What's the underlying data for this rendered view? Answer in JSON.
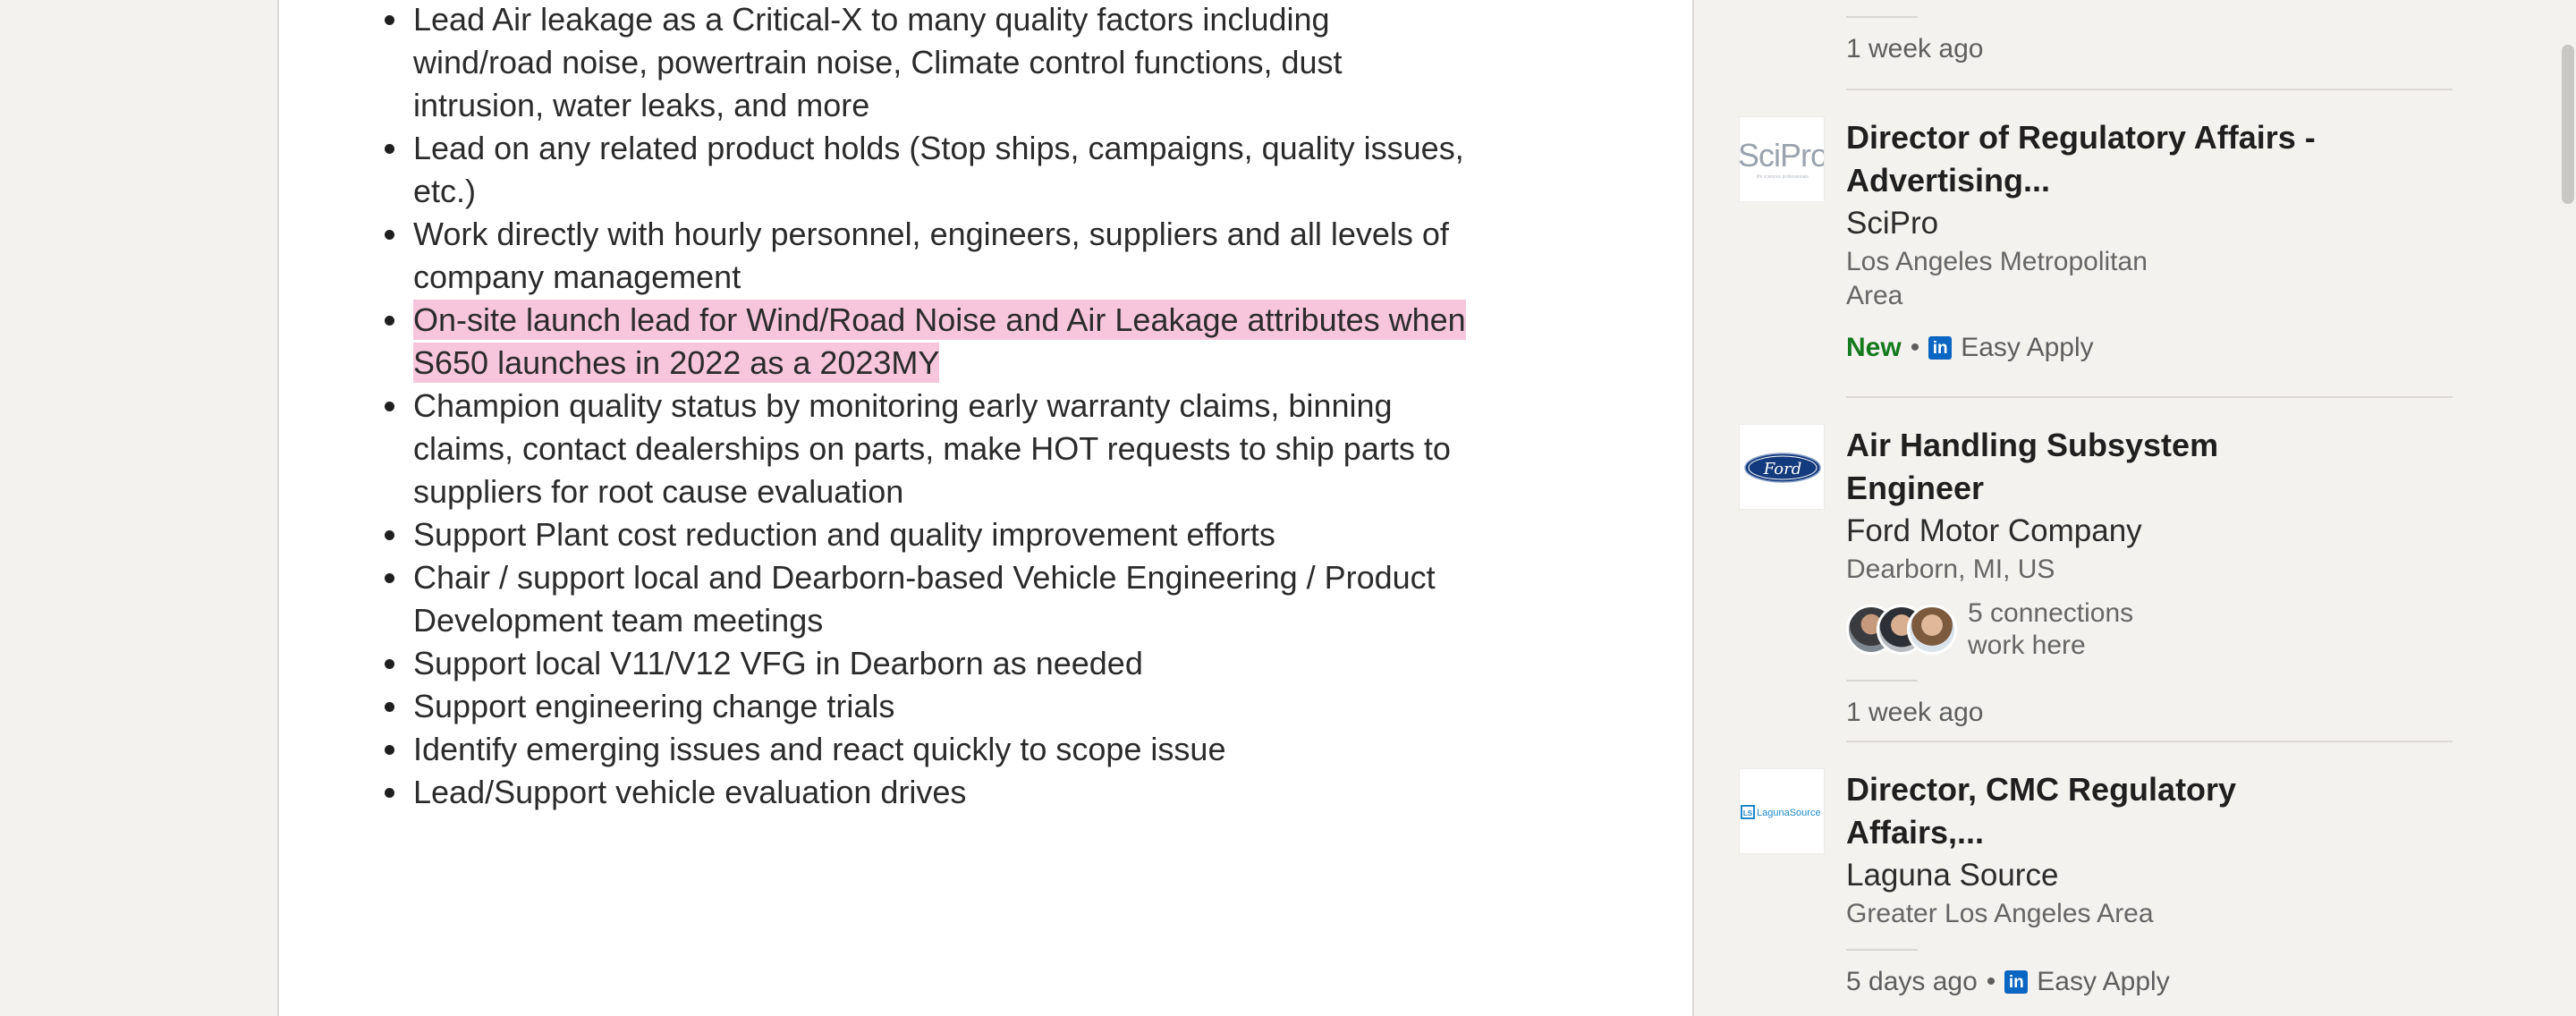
{
  "description": {
    "items": [
      "Lead Air leakage as a Critical-X to many quality factors including wind/road noise, powertrain noise, Climate control functions, dust intrusion, water leaks, and more",
      "Lead on any related product holds (Stop ships, campaigns, quality issues, etc.)",
      "Work directly with hourly personnel, engineers, suppliers and all levels of company management",
      "On-site launch lead for Wind/Road Noise and Air Leakage attributes when S650 launches in 2022 as a 2023MY",
      "Champion quality status by monitoring early warranty claims, binning claims, contact dealerships on parts, make HOT requests to ship parts to suppliers for root cause evaluation",
      "Support Plant cost reduction and quality improvement efforts",
      "Chair / support local and Dearborn-based Vehicle Engineering / Product Development team meetings",
      "Support local V11/V12 VFG in Dearborn as needed",
      "Support engineering change trials",
      "Identify emerging issues and react quickly to scope issue",
      "Lead/Support vehicle evaluation drives"
    ],
    "highlighted_index": 3,
    "highlight_color": "#f7c6dd"
  },
  "recommendations": {
    "top_time": "1 week ago",
    "jobs": [
      {
        "logo_icon": "scipro-logo",
        "logo_text": "SciPro",
        "logo_subtext": "life sciences professionals",
        "title": "Director of Regulatory Affairs - Advertising...",
        "company": "SciPro",
        "location": "Los Angeles Metropolitan Area",
        "new_label": "New",
        "dot": "•",
        "easy_apply": "Easy Apply",
        "li_glyph": "in"
      },
      {
        "logo_icon": "ford-logo",
        "logo_text": "Ford",
        "title": "Air Handling Subsystem Engineer",
        "company": "Ford Motor Company",
        "location": "Dearborn, MI, US",
        "connections": "5 connections work here",
        "time": "1 week ago"
      },
      {
        "logo_icon": "laguna-source-logo",
        "logo_text": "LagunaSource",
        "logo_badge": "LS",
        "title": "Director, CMC Regulatory Affairs,...",
        "company": "Laguna Source",
        "location": "Greater Los Angeles Area",
        "time": "5 days ago",
        "dot": "•",
        "easy_apply": "Easy Apply",
        "li_glyph": "in"
      }
    ]
  },
  "colors": {
    "page_bg": "#f3f2ef",
    "linkedin_blue": "#0a66c2",
    "new_green": "#147a1d",
    "ford_blue": "#133a7c"
  }
}
